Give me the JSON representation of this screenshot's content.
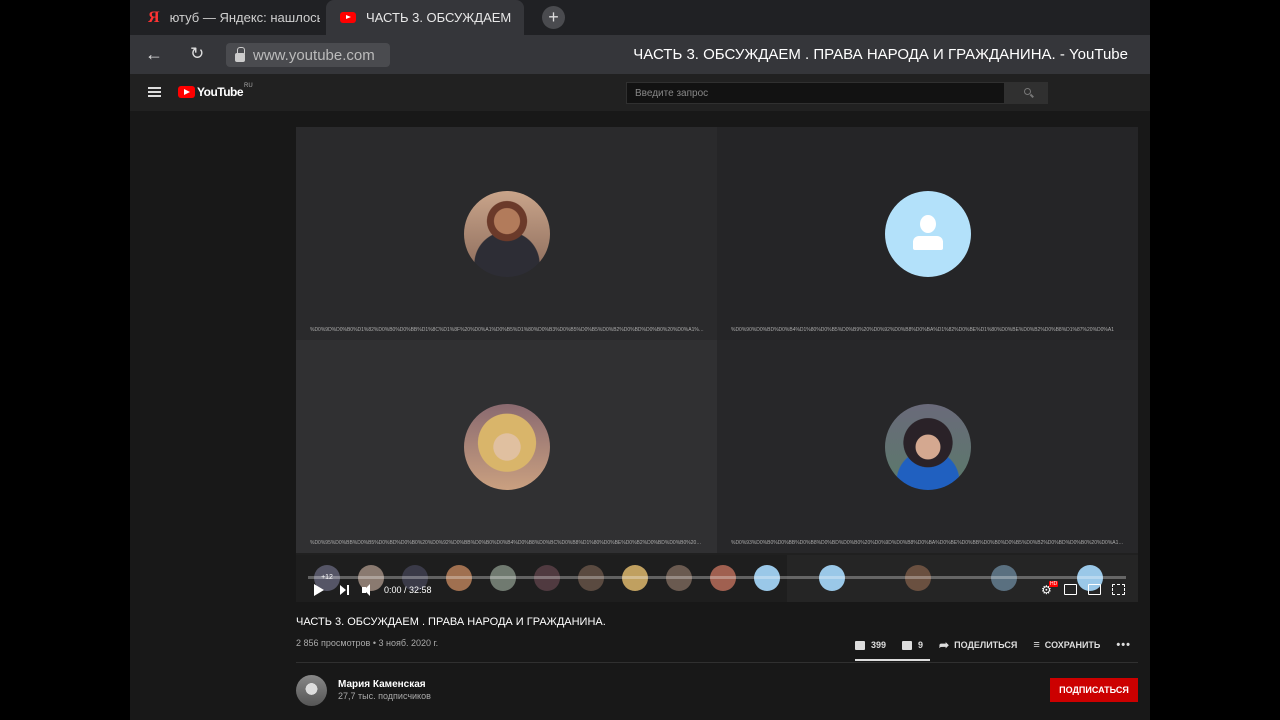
{
  "browser": {
    "tabs": [
      {
        "title": "ютуб — Яндекс: нашлось"
      },
      {
        "title": "ЧАСТЬ 3. ОБСУЖДАЕМ . ПРАВА НАРОДА И ГРАЖДАНИНА. - YouTube"
      }
    ],
    "url": "www.youtube.com",
    "page_title": "ЧАСТЬ 3. ОБСУЖДАЕМ . ПРАВА НАРОДА И ГРАЖДАНИНА. - YouTube"
  },
  "youtube": {
    "logo_text": "YouTube",
    "logo_region": "RU",
    "search_placeholder": "Введите запрос"
  },
  "video": {
    "participants": [
      {
        "encoded_name": "%D0%9D%D0%B0%D1%82%D0%B0%D0%BB%D1%8C%D1%8F%20%D0%A1%D0%B5%D1%80%D0%B3%D0%B5%D0%B5%D0%B2%D0%BD%D0%B0%20%D0%A1%D0%B0..."
      },
      {
        "encoded_name": "%D0%90%D0%BD%D0%B4%D1%80%D0%B5%D0%B9%20%D0%92%D0%B8%D0%BA%D1%82%D0%BE%D1%80%D0%BE%D0%B2%D0%B8%D1%87%20%D0%A1"
      },
      {
        "encoded_name": "%D0%95%D0%BB%D0%B5%D0%BD%D0%B0%20%D0%92%D0%BB%D0%B0%D0%B4%D0%B8%D0%BC%D0%B8%D1%80%D0%BE%D0%B2%D0%BD%D0%B0%20%D0"
      },
      {
        "encoded_name": "%D0%93%D0%B0%D0%BB%D0%B8%D0%BD%D0%B0%20%D0%9D%D0%B8%D0%BA%D0%BE%D0%BB%D0%B0%D0%B5%D0%B2%D0%BD%D0%B0%20%D0%A1%D0%B5%D0%BC..."
      }
    ],
    "strip_more_label": "+12",
    "time_label": "0:00 / 32:58",
    "progress": 0
  },
  "info": {
    "title": "ЧАСТЬ 3. ОБСУЖДАЕМ . ПРАВА НАРОДА И ГРАЖДАНИНА.",
    "meta": "2 856 просмотров • 3 нояб. 2020 г.",
    "likes": "399",
    "dislikes": "9",
    "share_label": "ПОДЕЛИТЬСЯ",
    "save_label": "СОХРАНИТЬ",
    "more_label": "•••"
  },
  "channel": {
    "name": "Мария Каменская",
    "subscribers": "27,7 тыс. подписчиков",
    "subscribe_label": "ПОДПИСАТЬСЯ"
  },
  "colors": {
    "subscribe": "#cc0000",
    "youtube_red": "#ff0000",
    "default_avatar": "#b3e1fa"
  }
}
